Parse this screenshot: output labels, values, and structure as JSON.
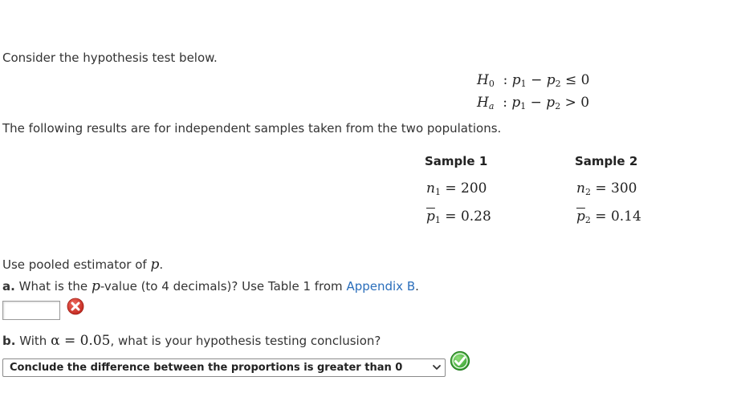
{
  "intro": "Consider the hypothesis test below.",
  "hypotheses": {
    "h0_symbol": "H",
    "h0_sub": "0",
    "ha_symbol": "H",
    "ha_sub": "a",
    "h0_rel": "≤ 0",
    "ha_rel": "> 0"
  },
  "following_text": "The following results are for independent samples taken from the two populations.",
  "samples": {
    "sample1_label": "Sample 1",
    "sample2_label": "Sample 2",
    "n1_value": "200",
    "n2_value": "300",
    "p1_value": "0.28",
    "p2_value": "0.14"
  },
  "pooled": {
    "text": "Use pooled estimator of",
    "var": "p",
    "period": "."
  },
  "question_a": {
    "prefix": "a.",
    "text_before": "What is the",
    "var": "p",
    "text_after": "-value (to 4 decimals)? Use Table 1 from",
    "link": "Appendix B",
    "period": ".",
    "input_value": "",
    "status": "incorrect",
    "status_icon": "x-circle-icon"
  },
  "question_b": {
    "prefix": "b.",
    "text_before": "With",
    "alpha_expr": "α = 0.05",
    "text_after": ", what is your hypothesis testing conclusion?",
    "selected_option": "Conclude the difference between the proportions is greater than 0",
    "status": "correct",
    "status_icon": "check-circle-icon"
  },
  "colors": {
    "link": "#2a6ebb",
    "error": "#d0342c",
    "success": "#3aa835"
  }
}
